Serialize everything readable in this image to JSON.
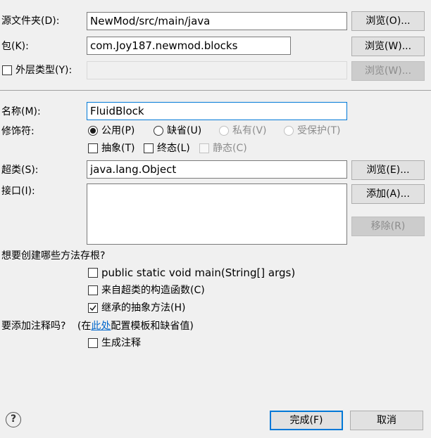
{
  "source_folder": {
    "label": "源文件夹(D):",
    "value": "NewMod/src/main/java",
    "browse": "浏览(O)..."
  },
  "package": {
    "label": "包(K):",
    "value": "com.Joy187.newmod.blocks",
    "browse": "浏览(W)..."
  },
  "enclosing_type": {
    "label": "外层类型(Y):",
    "value": "",
    "browse": "浏览(W)..."
  },
  "name": {
    "label": "名称(M):",
    "value": "FluidBlock"
  },
  "modifiers": {
    "label": "修饰符:",
    "public": "公用(P)",
    "default": "缺省(U)",
    "private": "私有(V)",
    "protected": "受保护(T)",
    "abstract": "抽象(T)",
    "final": "终态(L)",
    "static": "静态(C)"
  },
  "superclass": {
    "label": "超类(S):",
    "value": "java.lang.Object",
    "browse": "浏览(E)..."
  },
  "interfaces": {
    "label": "接口(I):",
    "add": "添加(A)...",
    "remove": "移除(R)"
  },
  "stubs": {
    "question": "想要创建哪些方法存根?",
    "main": "public static void main(String[] args)",
    "constructors": "来自超类的构造函数(C)",
    "inherited": "继承的抽象方法(H)"
  },
  "comments": {
    "question": "要添加注释吗?",
    "hint_prefix": "(在",
    "hint_link": "此处",
    "hint_suffix": "配置模板和缺省值)",
    "generate": "生成注释"
  },
  "footer": {
    "help": "?",
    "finish": "完成(F)",
    "cancel": "取消"
  }
}
